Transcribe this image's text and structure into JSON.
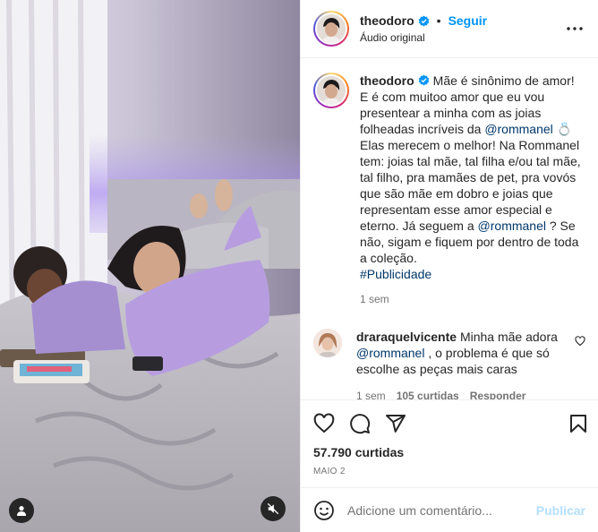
{
  "header": {
    "username": "theodoro",
    "separator": "•",
    "follow_label": "Seguir",
    "audio_label": "Áudio original",
    "more_icon": "more-horizontal-icon"
  },
  "caption": {
    "username": "theodoro",
    "text_part1": "Mãe é sinônimo de amor! E é com muitoo amor que eu vou presentear a minha com as joias folheadas incríveis da ",
    "mention1": "@rommanel",
    "ring_emoji": "💍",
    "text_part2": " Elas merecem o melhor! Na Rommanel tem: joias tal mãe, tal filha e/ou tal mãe, tal filho, pra mamães de pet, pra vovós que são mãe em dobro e joias que representam esse amor especial e eterno. Já seguem a ",
    "mention2": "@rommanel",
    "text_part3": " ? Se não, sigam e fiquem por dentro de toda a coleção.",
    "hashtag": "#Publicidade",
    "time": "1 sem"
  },
  "comment": {
    "username": "draraquelvicente",
    "text_part1": "Minha mãe adora ",
    "mention": "@rommanel",
    "text_part2": " , o problema é que só escolhe as peças mais caras",
    "time": "1 sem",
    "likes": "105 curtidas",
    "reply_label": "Responder"
  },
  "actions": {
    "like_icon": "heart-icon",
    "comment_icon": "comment-icon",
    "share_icon": "share-icon",
    "save_icon": "bookmark-icon",
    "likes_count": "57.790 curtidas",
    "date": "MAIO 2"
  },
  "add_comment": {
    "placeholder": "Adicione um comentário...",
    "post_label": "Publicar"
  },
  "colors": {
    "accent": "#0095f6",
    "link": "#00376b",
    "muted": "#737373",
    "post_disabled": "#b2dffc"
  }
}
